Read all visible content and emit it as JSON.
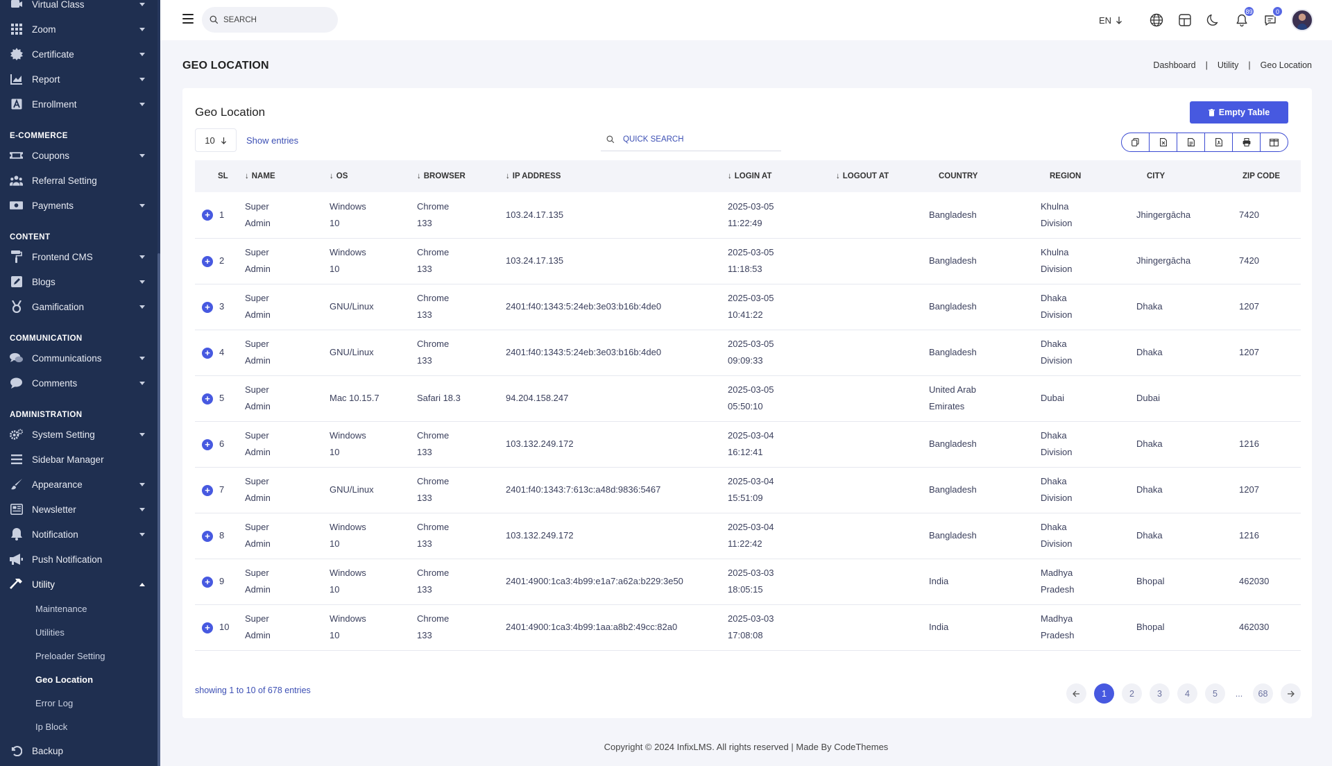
{
  "sidebar": {
    "items_top": [
      {
        "label": "Virtual Class",
        "icon": "virtual-class-icon",
        "caret": true
      },
      {
        "label": "Zoom",
        "icon": "grid-icon",
        "caret": true
      },
      {
        "label": "Certificate",
        "icon": "certificate-icon",
        "caret": true
      },
      {
        "label": "Report",
        "icon": "chart-icon",
        "caret": true
      },
      {
        "label": "Enrollment",
        "icon": "enrollment-icon",
        "caret": true
      }
    ],
    "section_ecommerce": "E-COMMERCE",
    "items_ecommerce": [
      {
        "label": "Coupons",
        "icon": "coupon-icon",
        "caret": true
      },
      {
        "label": "Referral Setting",
        "icon": "users-icon",
        "caret": false
      },
      {
        "label": "Payments",
        "icon": "money-icon",
        "caret": true
      }
    ],
    "section_content": "CONTENT",
    "items_content": [
      {
        "label": "Frontend CMS",
        "icon": "paint-roller-icon",
        "caret": true
      },
      {
        "label": "Blogs",
        "icon": "edit-icon",
        "caret": true
      },
      {
        "label": "Gamification",
        "icon": "medal-icon",
        "caret": true
      }
    ],
    "section_communication": "COMMUNICATION",
    "items_communication": [
      {
        "label": "Communications",
        "icon": "comments-icon",
        "caret": true
      },
      {
        "label": "Comments",
        "icon": "comment-icon",
        "caret": true
      }
    ],
    "section_administration": "ADMINISTRATION",
    "items_administration": [
      {
        "label": "System Setting",
        "icon": "cogs-icon",
        "caret": true
      },
      {
        "label": "Sidebar Manager",
        "icon": "bars-icon",
        "caret": false
      },
      {
        "label": "Appearance",
        "icon": "brush-icon",
        "caret": true
      },
      {
        "label": "Newsletter",
        "icon": "newsletter-icon",
        "caret": true
      },
      {
        "label": "Notification",
        "icon": "bell-icon",
        "caret": true
      },
      {
        "label": "Push Notification",
        "icon": "megaphone-icon",
        "caret": false
      }
    ],
    "utility": {
      "label": "Utility",
      "icon": "hammer-icon"
    },
    "utility_sub": [
      "Maintenance",
      "Utilities",
      "Preloader Setting",
      "Geo Location",
      "Error Log",
      "Ip Block"
    ],
    "utility_current": "Geo Location",
    "backup": {
      "label": "Backup",
      "icon": "undo-icon"
    }
  },
  "topbar": {
    "search_placeholder": "SEARCH",
    "lang": "EN",
    "notification_count": "89",
    "message_count": "0"
  },
  "page": {
    "title": "GEO LOCATION",
    "breadcrumb": [
      "Dashboard",
      "Utility",
      "Geo Location"
    ]
  },
  "card": {
    "title": "Geo Location",
    "empty_button": "Empty Table",
    "entries_value": "10",
    "entries_label": "Show entries",
    "quick_search_placeholder": "QUICK SEARCH"
  },
  "table": {
    "headers": {
      "sl": "SL",
      "name": "NAME",
      "os": "OS",
      "browser": "BROWSER",
      "ip": "IP ADDRESS",
      "login": "LOGIN AT",
      "logout": "LOGOUT AT",
      "country": "COUNTRY",
      "region": "REGION",
      "city": "CITY",
      "zip": "ZIP CODE"
    },
    "rows": [
      {
        "sl": "1",
        "name": [
          "Super",
          "Admin"
        ],
        "os": [
          "Windows",
          "10"
        ],
        "browser": [
          "Chrome",
          "133"
        ],
        "ip": "103.24.17.135",
        "login": [
          "2025-03-05",
          "11:22:49"
        ],
        "logout": "",
        "country": [
          "Bangladesh"
        ],
        "region": [
          "Khulna",
          "Division"
        ],
        "city": "Jhingergācha",
        "zip": "7420"
      },
      {
        "sl": "2",
        "name": [
          "Super",
          "Admin"
        ],
        "os": [
          "Windows",
          "10"
        ],
        "browser": [
          "Chrome",
          "133"
        ],
        "ip": "103.24.17.135",
        "login": [
          "2025-03-05",
          "11:18:53"
        ],
        "logout": "",
        "country": [
          "Bangladesh"
        ],
        "region": [
          "Khulna",
          "Division"
        ],
        "city": "Jhingergācha",
        "zip": "7420"
      },
      {
        "sl": "3",
        "name": [
          "Super",
          "Admin"
        ],
        "os": [
          "GNU/Linux"
        ],
        "browser": [
          "Chrome",
          "133"
        ],
        "ip": "2401:f40:1343:5:24eb:3e03:b16b:4de0",
        "login": [
          "2025-03-05",
          "10:41:22"
        ],
        "logout": "",
        "country": [
          "Bangladesh"
        ],
        "region": [
          "Dhaka",
          "Division"
        ],
        "city": "Dhaka",
        "zip": "1207"
      },
      {
        "sl": "4",
        "name": [
          "Super",
          "Admin"
        ],
        "os": [
          "GNU/Linux"
        ],
        "browser": [
          "Chrome",
          "133"
        ],
        "ip": "2401:f40:1343:5:24eb:3e03:b16b:4de0",
        "login": [
          "2025-03-05",
          "09:09:33"
        ],
        "logout": "",
        "country": [
          "Bangladesh"
        ],
        "region": [
          "Dhaka",
          "Division"
        ],
        "city": "Dhaka",
        "zip": "1207"
      },
      {
        "sl": "5",
        "name": [
          "Super",
          "Admin"
        ],
        "os": [
          "Mac 10.15.7"
        ],
        "browser": [
          "Safari 18.3"
        ],
        "ip": "94.204.158.247",
        "login": [
          "2025-03-05",
          "05:50:10"
        ],
        "logout": "",
        "country": [
          "United Arab",
          "Emirates"
        ],
        "region": [
          "Dubai"
        ],
        "city": "Dubai",
        "zip": ""
      },
      {
        "sl": "6",
        "name": [
          "Super",
          "Admin"
        ],
        "os": [
          "Windows",
          "10"
        ],
        "browser": [
          "Chrome",
          "133"
        ],
        "ip": "103.132.249.172",
        "login": [
          "2025-03-04",
          "16:12:41"
        ],
        "logout": "",
        "country": [
          "Bangladesh"
        ],
        "region": [
          "Dhaka",
          "Division"
        ],
        "city": "Dhaka",
        "zip": "1216"
      },
      {
        "sl": "7",
        "name": [
          "Super",
          "Admin"
        ],
        "os": [
          "GNU/Linux"
        ],
        "browser": [
          "Chrome",
          "133"
        ],
        "ip": "2401:f40:1343:7:613c:a48d:9836:5467",
        "login": [
          "2025-03-04",
          "15:51:09"
        ],
        "logout": "",
        "country": [
          "Bangladesh"
        ],
        "region": [
          "Dhaka",
          "Division"
        ],
        "city": "Dhaka",
        "zip": "1207"
      },
      {
        "sl": "8",
        "name": [
          "Super",
          "Admin"
        ],
        "os": [
          "Windows",
          "10"
        ],
        "browser": [
          "Chrome",
          "133"
        ],
        "ip": "103.132.249.172",
        "login": [
          "2025-03-04",
          "11:22:42"
        ],
        "logout": "",
        "country": [
          "Bangladesh"
        ],
        "region": [
          "Dhaka",
          "Division"
        ],
        "city": "Dhaka",
        "zip": "1216"
      },
      {
        "sl": "9",
        "name": [
          "Super",
          "Admin"
        ],
        "os": [
          "Windows",
          "10"
        ],
        "browser": [
          "Chrome",
          "133"
        ],
        "ip": "2401:4900:1ca3:4b99:e1a7:a62a:b229:3e50",
        "login": [
          "2025-03-03",
          "18:05:15"
        ],
        "logout": "",
        "country": [
          "India"
        ],
        "region": [
          "Madhya",
          "Pradesh"
        ],
        "city": "Bhopal",
        "zip": "462030"
      },
      {
        "sl": "10",
        "name": [
          "Super",
          "Admin"
        ],
        "os": [
          "Windows",
          "10"
        ],
        "browser": [
          "Chrome",
          "133"
        ],
        "ip": "2401:4900:1ca3:4b99:1aa:a8b2:49cc:82a0",
        "login": [
          "2025-03-03",
          "17:08:08"
        ],
        "logout": "",
        "country": [
          "India"
        ],
        "region": [
          "Madhya",
          "Pradesh"
        ],
        "city": "Bhopal",
        "zip": "462030"
      }
    ]
  },
  "pagination": {
    "showing": "showing 1 to 10 of 678 entries",
    "pages": [
      "1",
      "2",
      "3",
      "4",
      "5",
      "...",
      "68"
    ],
    "current": "1"
  },
  "footer": {
    "copyright": "Copyright © 2024 InfixLMS. All rights reserved | Made By CodeThemes"
  },
  "colors": {
    "sidebar_bg": "#1f2f50",
    "accent": "#4759e0",
    "link": "#3c4fb4"
  }
}
